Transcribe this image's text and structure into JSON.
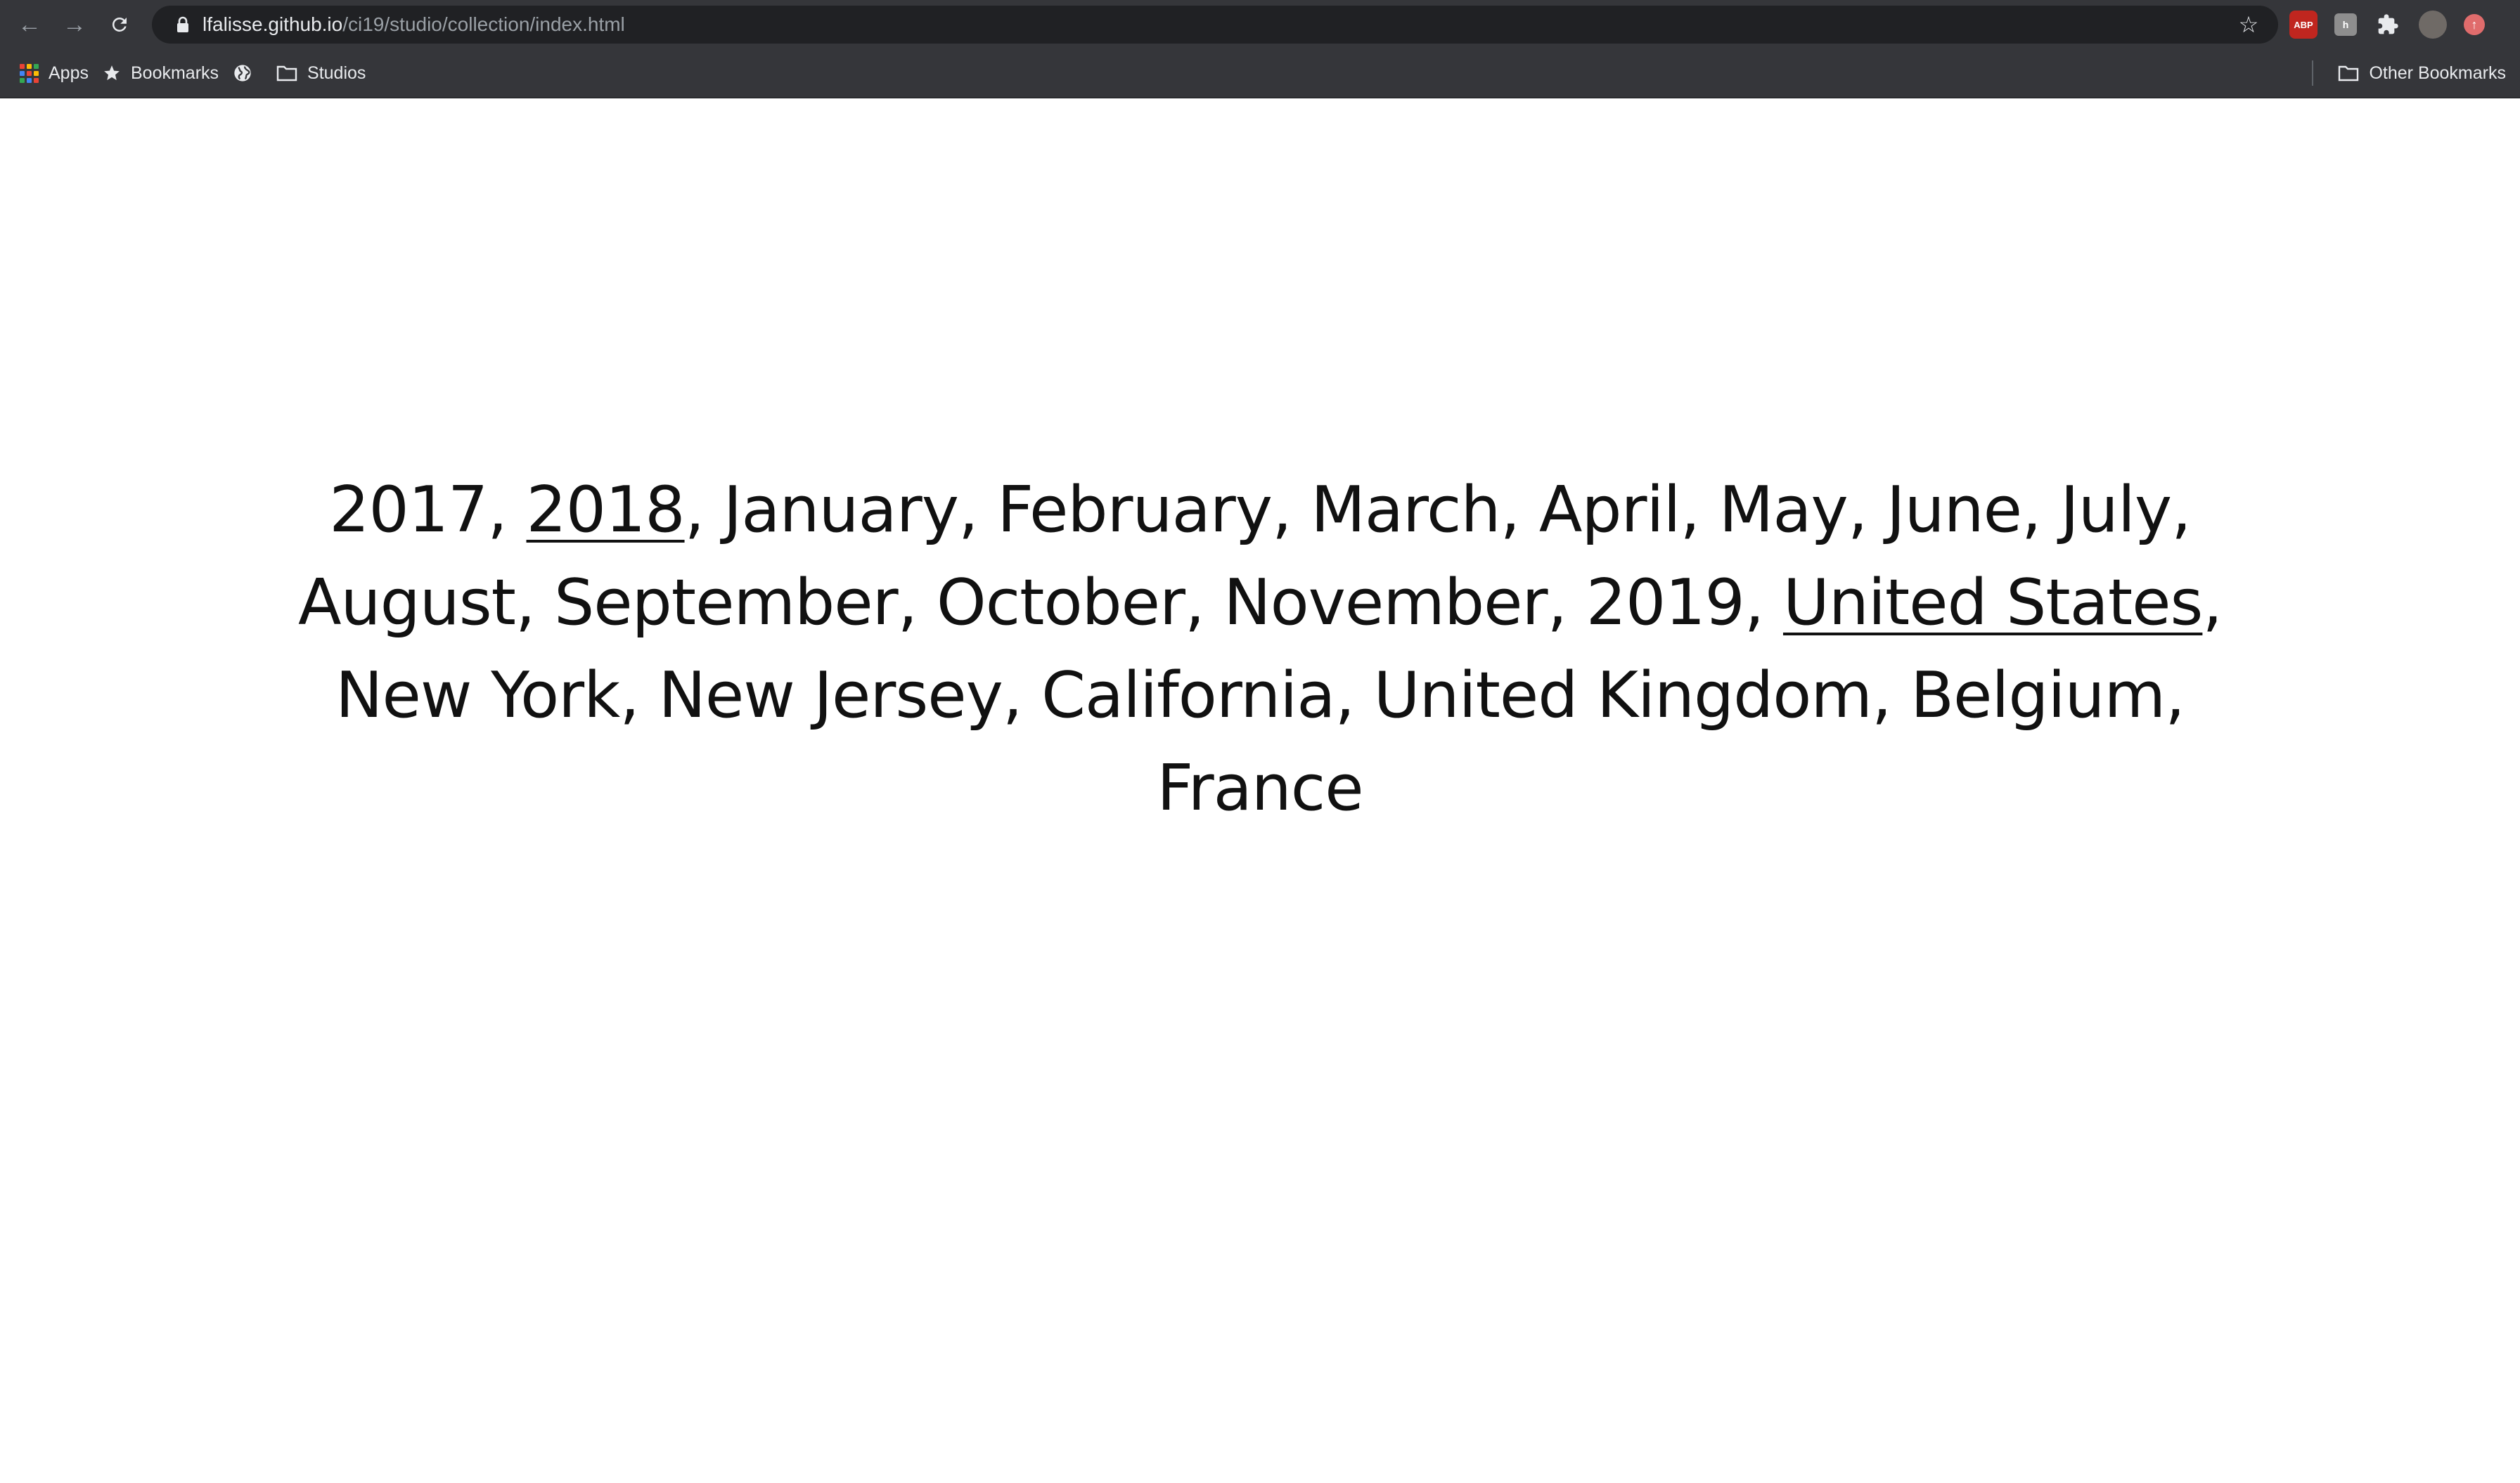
{
  "browser": {
    "url_host": "lfalisse.github.io",
    "url_path": "/ci19/studio/collection/index.html",
    "extensions": [
      "ABP",
      "h"
    ]
  },
  "bookmarks_bar": {
    "items": [
      {
        "label": "Apps",
        "icon": "apps-grid-icon"
      },
      {
        "label": "Bookmarks",
        "icon": "star-icon"
      },
      {
        "label": "",
        "icon": "globe-icon"
      },
      {
        "label": "Studios",
        "icon": "folder-icon"
      }
    ],
    "other_label": "Other Bookmarks"
  },
  "tags": [
    {
      "label": "2017",
      "active": false
    },
    {
      "label": "2018",
      "active": true
    },
    {
      "label": "January",
      "active": false
    },
    {
      "label": "February",
      "active": false
    },
    {
      "label": "March",
      "active": false
    },
    {
      "label": "April",
      "active": false
    },
    {
      "label": "May",
      "active": false
    },
    {
      "label": "June",
      "active": false
    },
    {
      "label": "July",
      "active": false
    },
    {
      "label": "August",
      "active": false
    },
    {
      "label": "September",
      "active": false
    },
    {
      "label": "October",
      "active": false
    },
    {
      "label": "November",
      "active": false
    },
    {
      "label": "2019",
      "active": false
    },
    {
      "label": "United States",
      "active": true
    },
    {
      "label": "New York",
      "active": false
    },
    {
      "label": "New Jersey",
      "active": false
    },
    {
      "label": "California",
      "active": false
    },
    {
      "label": "United Kingdom",
      "active": false
    },
    {
      "label": "Belgium",
      "active": false
    },
    {
      "label": "France",
      "active": false
    }
  ],
  "separator": ", "
}
